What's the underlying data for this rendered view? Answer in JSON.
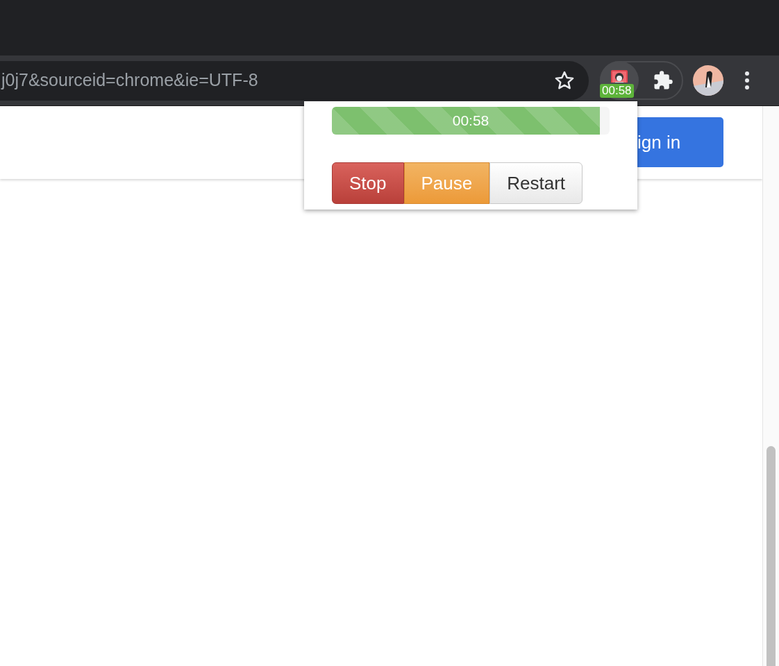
{
  "address_bar": {
    "url": "j0j7&sourceid=chrome&ie=UTF-8",
    "bookmarked": false
  },
  "extension": {
    "badge": "00:58"
  },
  "page": {
    "sign_in": "ign in"
  },
  "popup": {
    "progress": {
      "level": 0.965,
      "label": "00:58"
    },
    "buttons": [
      {
        "label": "Stop",
        "kind": "danger"
      },
      {
        "label": "Pause",
        "kind": "warning"
      },
      {
        "label": "Restart",
        "kind": "default"
      }
    ]
  }
}
